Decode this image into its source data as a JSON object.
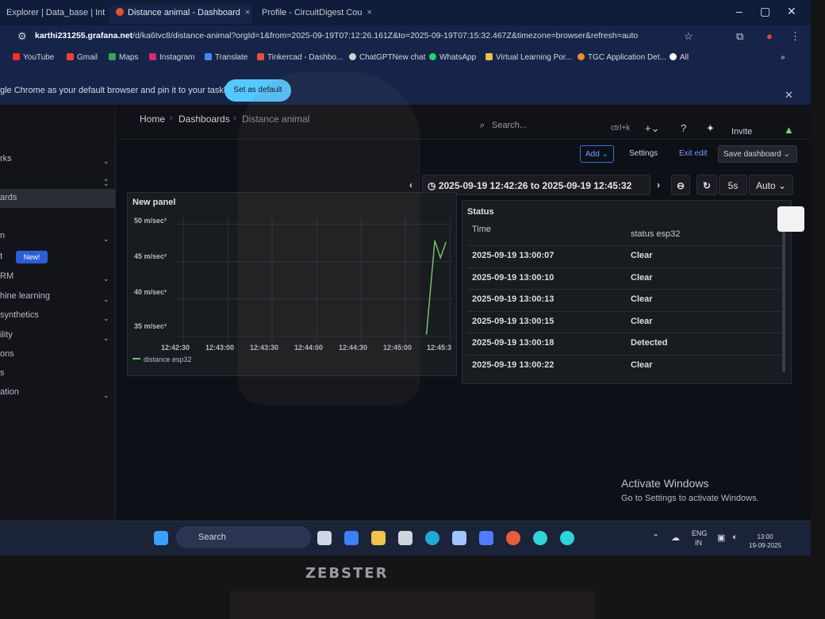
{
  "browser": {
    "tabs": [
      {
        "label": "Explorer | Data_base | Int",
        "close": "×"
      },
      {
        "label": "Distance animal - Dashboard",
        "close": "×"
      },
      {
        "label": "Profile - CircuitDigest Cou",
        "close": "×"
      }
    ],
    "window_controls": {
      "minimize": "–",
      "maximize": "▢",
      "close": "✕"
    },
    "url_host": "karthi231255.grafana.net",
    "url_path": "/d/ka6tvc8/distance-animal?orgId=1&from=2025-09-19T07:12:26.161Z&to=2025-09-19T07:15:32.467Z&timezone=browser&refresh=auto",
    "bookmarks": [
      {
        "label": "YouTube",
        "color": "#ff2a2a"
      },
      {
        "label": "Gmail",
        "color": "#ea4335"
      },
      {
        "label": "Maps",
        "color": "#34a853"
      },
      {
        "label": "Instagram",
        "color": "#d62976"
      },
      {
        "label": "Translate",
        "color": "#4285f4"
      },
      {
        "label": "Tinkercad - Dashbo...",
        "color": "#e84e3a"
      },
      {
        "label": "ChatGPTNew chat",
        "color": "#d0d0d0"
      },
      {
        "label": "WhatsApp",
        "color": "#25d366"
      },
      {
        "label": "Virtual Learning Por...",
        "color": "#e8c14a"
      },
      {
        "label": "TGC Application Det...",
        "color": "#f08a24"
      },
      {
        "label": "All",
        "color": "#ffffff"
      }
    ],
    "infobar_text": "gle Chrome as your default browser and pin it to your taskbar",
    "infobar_button": "Set as default"
  },
  "grafana": {
    "breadcrumb": [
      "Home",
      "Dashboards",
      "Distance animal"
    ],
    "search_placeholder": "Search...",
    "search_shortcut": "ctrl+k",
    "invite_label": "Invite",
    "toolbar": {
      "add": "Add ⌄",
      "settings": "Settings",
      "exit_edit": "Exit edit",
      "save_dashboard": "Save dashboard ⌄"
    },
    "time_range": "2025-09-19 12:42:26 to 2025-09-19 12:45:32",
    "refresh_interval": "5s",
    "refresh_mode": "Auto ⌄",
    "sidebar": [
      {
        "label": "rks",
        "chevron": "⌄"
      },
      {
        "label": "",
        "chevron": "⌄"
      },
      {
        "label": "ards",
        "chevron": "⌄"
      },
      {
        "label": "n",
        "chevron": "⌄"
      },
      {
        "label": "t",
        "chevron": ""
      },
      {
        "label": "RM",
        "chevron": "⌄"
      },
      {
        "label": "hine learning",
        "chevron": "⌄"
      },
      {
        "label": "synthetics",
        "chevron": "⌄"
      },
      {
        "label": "ility",
        "chevron": "⌄"
      },
      {
        "label": "ons",
        "chevron": ""
      },
      {
        "label": "s",
        "chevron": ""
      },
      {
        "label": "ation",
        "chevron": "⌄"
      }
    ],
    "sidebar_new_badge": "New!"
  },
  "chart_data": {
    "type": "line",
    "title": "New panel",
    "yticks": [
      "50 m/sec²",
      "45 m/sec²",
      "40 m/sec²",
      "35 m/sec²"
    ],
    "ylim": [
      34,
      51
    ],
    "xticks": [
      "12:42:30",
      "12:43:00",
      "12:43:30",
      "12:44:00",
      "12:44:30",
      "12:45:00",
      "12:45:3"
    ],
    "series": [
      {
        "name": "distance esp32",
        "color": "#73bf69",
        "points": [
          [
            0.905,
            35.2
          ],
          [
            0.935,
            47.8
          ],
          [
            0.955,
            45.5
          ],
          [
            0.975,
            47.6
          ]
        ]
      }
    ],
    "legend": "distance esp32",
    "grid": true
  },
  "status_panel": {
    "title": "Status",
    "columns": [
      "Time",
      "status esp32"
    ],
    "rows": [
      {
        "time": "2025-09-19 13:00:07",
        "status": "Clear"
      },
      {
        "time": "2025-09-19 13:00:10",
        "status": "Clear"
      },
      {
        "time": "2025-09-19 13:00:13",
        "status": "Clear"
      },
      {
        "time": "2025-09-19 13:00:15",
        "status": "Clear"
      },
      {
        "time": "2025-09-19 13:00:18",
        "status": "Detected"
      },
      {
        "time": "2025-09-19 13:00:22",
        "status": "Clear"
      }
    ]
  },
  "windows": {
    "activate_title": "Activate Windows",
    "activate_sub": "Go to Settings to activate Windows.",
    "taskbar_search": "Search",
    "lang": "ENG",
    "region": "IN",
    "time": "13:00",
    "date": "19-09-2025"
  },
  "monitor_brand": "ZEBSTER"
}
